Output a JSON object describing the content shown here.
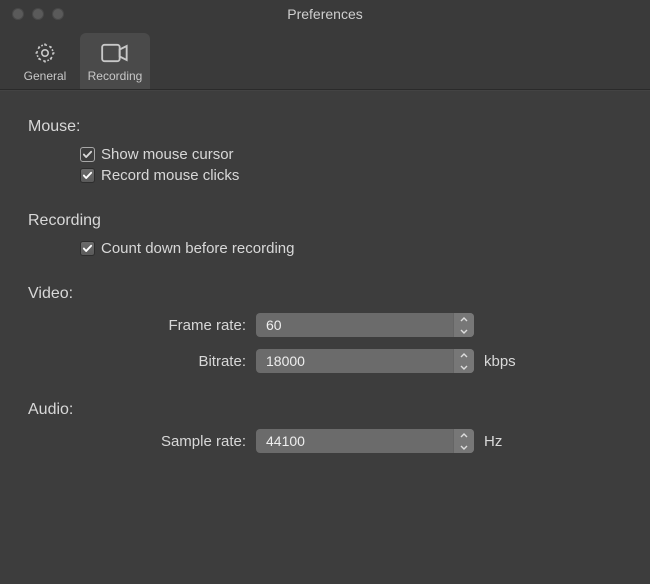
{
  "window": {
    "title": "Preferences"
  },
  "tabs": {
    "general": "General",
    "recording": "Recording"
  },
  "sections": {
    "mouse": {
      "header": "Mouse:",
      "show_cursor": "Show mouse cursor",
      "record_clicks": "Record mouse clicks"
    },
    "recording": {
      "header": "Recording",
      "countdown": "Count down before recording"
    },
    "video": {
      "header": "Video:",
      "frame_rate_label": "Frame rate:",
      "frame_rate_value": "60",
      "bitrate_label": "Bitrate:",
      "bitrate_value": "18000",
      "bitrate_unit": "kbps"
    },
    "audio": {
      "header": "Audio:",
      "sample_rate_label": "Sample rate:",
      "sample_rate_value": "44100",
      "sample_rate_unit": "Hz"
    }
  }
}
